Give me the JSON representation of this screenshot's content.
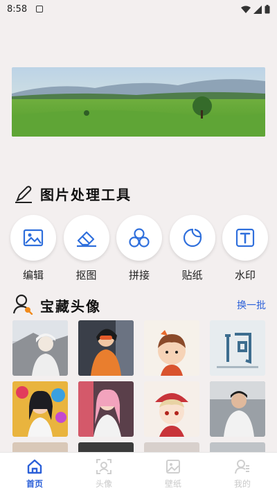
{
  "status": {
    "time": "8:58"
  },
  "tools_section": {
    "title": "图片处理工具"
  },
  "tools": [
    {
      "label": "编辑",
      "icon": "image-icon"
    },
    {
      "label": "抠图",
      "icon": "eraser-icon"
    },
    {
      "label": "拼接",
      "icon": "collage-icon"
    },
    {
      "label": "贴纸",
      "icon": "sticker-icon"
    },
    {
      "label": "水印",
      "icon": "text-watermark-icon"
    }
  ],
  "avatars_section": {
    "title": "宝藏头像",
    "refresh_label": "换一批"
  },
  "tabs": [
    {
      "label": "首页",
      "icon": "home-icon",
      "active": true
    },
    {
      "label": "头像",
      "icon": "avatar-icon",
      "active": false
    },
    {
      "label": "壁纸",
      "icon": "wallpaper-icon",
      "active": false
    },
    {
      "label": "我的",
      "icon": "profile-icon",
      "active": false
    }
  ],
  "colors": {
    "accent": "#2a5fd8",
    "background": "#f3efef",
    "icon_blue": "#2f6fdc"
  }
}
